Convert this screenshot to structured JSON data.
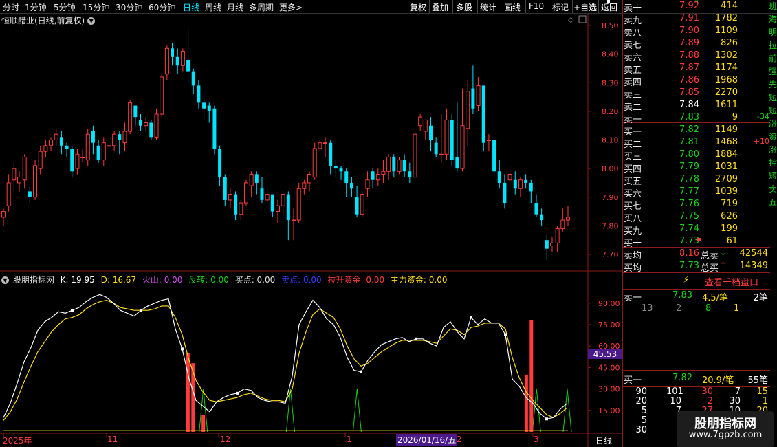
{
  "toolbar": {
    "periods": [
      "分时",
      "1分钟",
      "5分钟",
      "15分钟",
      "30分钟",
      "60分钟",
      "日线",
      "周线",
      "月线",
      "多周期",
      "更多"
    ],
    "active_period": "日线",
    "more_arrow": ">",
    "tools": [
      "复权",
      "叠加",
      "多股",
      "统计",
      "画线",
      "F10",
      "标记",
      "+自选",
      "返回"
    ]
  },
  "chart_title": "恒顺醋业(日线,前复权)",
  "price_axis": [
    "8.50",
    "8.40",
    "8.30",
    "8.20",
    "8.10",
    "8.00",
    "7.90",
    "7.80",
    "7.70"
  ],
  "indicator": {
    "name": "股朋指标网",
    "k_label": "K: 19.95",
    "d_label": "D: 16.67",
    "huoshan": "火山: 0.00",
    "fanzhuan": "反转: 0.00",
    "maidian": "买点: 0.00",
    "maidian2": "卖点: 0.00",
    "lasheng": "拉升资金: 0.00",
    "zhuli": "主力资金: 0.00",
    "axis": [
      "90.00",
      "75.00",
      "60.00",
      "45.00",
      "30.00",
      "15.00"
    ],
    "current_badge": "45.53"
  },
  "time_axis": {
    "labels": [
      "2025年",
      "11",
      "12",
      "1",
      "2",
      "3"
    ],
    "cursor_date": "2026/01/16/五",
    "period": "日线"
  },
  "orderbook": {
    "asks": [
      {
        "label": "卖十",
        "price": "7.92",
        "vol": "414",
        "flag": "*"
      },
      {
        "label": "卖九",
        "price": "7.91",
        "vol": "1782"
      },
      {
        "label": "卖八",
        "price": "7.90",
        "vol": "1109"
      },
      {
        "label": "卖七",
        "price": "7.89",
        "vol": "826"
      },
      {
        "label": "卖六",
        "price": "7.88",
        "vol": "1302"
      },
      {
        "label": "卖五",
        "price": "7.87",
        "vol": "1174"
      },
      {
        "label": "卖四",
        "price": "7.86",
        "vol": "1968"
      },
      {
        "label": "卖三",
        "price": "7.85",
        "vol": "2270"
      },
      {
        "label": "卖二",
        "price": "7.84",
        "vol": "1611"
      },
      {
        "label": "卖一",
        "price": "7.83",
        "vol": "9",
        "chg": "-34"
      }
    ],
    "bids": [
      {
        "label": "买一",
        "price": "7.82",
        "vol": "1149"
      },
      {
        "label": "买二",
        "price": "7.81",
        "vol": "1468",
        "chg": "+10"
      },
      {
        "label": "买三",
        "price": "7.80",
        "vol": "1884"
      },
      {
        "label": "买四",
        "price": "7.79",
        "vol": "1031"
      },
      {
        "label": "买五",
        "price": "7.78",
        "vol": "2709"
      },
      {
        "label": "买六",
        "price": "7.77",
        "vol": "1039"
      },
      {
        "label": "买七",
        "price": "7.76",
        "vol": "719"
      },
      {
        "label": "买八",
        "price": "7.75",
        "vol": "626"
      },
      {
        "label": "买九",
        "price": "7.74",
        "vol": "199"
      },
      {
        "label": "买十",
        "price": "7.73",
        "vol": "61"
      }
    ],
    "avg_sell_label": "卖均",
    "avg_sell": "8.16",
    "total_sell_label": "总卖",
    "total_sell": "42544",
    "avg_buy_label": "买均",
    "avg_buy": "7.73",
    "total_buy_label": "总买",
    "total_buy": "14349",
    "depth_button": "查看千档盘口",
    "ask1_detail": {
      "label": "卖一",
      "price": "7.83",
      "per": "4.5/笔",
      "count": "2笔"
    },
    "ask1_queue": [
      "13",
      "2",
      "8",
      "1"
    ],
    "bid1_detail": {
      "label": "买一",
      "price": "7.82",
      "per": "20.9/笔",
      "count": "55笔"
    },
    "bid1_queue": [
      [
        "90",
        "101",
        "30",
        "7",
        "15"
      ],
      [
        "20",
        "10",
        "2",
        "30",
        "1"
      ],
      [
        "5",
        "7",
        "27",
        "10",
        "20"
      ],
      [
        "5",
        "",
        "",
        "",
        ""
      ],
      [
        "30",
        "",
        "",
        "",
        ""
      ]
    ]
  },
  "side_text": [
    "班",
    "海",
    "明",
    "拉",
    "前",
    "强",
    "先",
    "短",
    "短",
    "涨",
    "资",
    "涨",
    "控",
    "短",
    "卖",
    "五"
  ],
  "watermark": {
    "title": "股朋指标网",
    "url": "www.7gpzb.com"
  },
  "colors": {
    "up": "#ff3c3c",
    "down": "#00e5ff",
    "k_line": "#ffffff",
    "d_line": "#ffde1a",
    "pulse": "#1ad01a"
  },
  "chart_data": [
    {
      "type": "candlestick",
      "title": "恒顺醋业(日线,前复权)",
      "y_range": [
        7.66,
        8.53
      ],
      "candles": [
        [
          7.83,
          7.85,
          7.8,
          7.86
        ],
        [
          7.87,
          7.95,
          7.85,
          7.98
        ],
        [
          7.96,
          8.0,
          7.92,
          8.02
        ],
        [
          7.95,
          7.97,
          7.92,
          7.99
        ],
        [
          7.96,
          8.04,
          7.93,
          8.05
        ],
        [
          7.92,
          7.9,
          7.88,
          7.94
        ],
        [
          7.9,
          8.01,
          7.89,
          8.03
        ],
        [
          8.0,
          8.06,
          7.98,
          8.08
        ],
        [
          8.06,
          8.08,
          8.04,
          8.1
        ],
        [
          8.08,
          8.1,
          8.06,
          8.11
        ],
        [
          8.1,
          8.12,
          8.08,
          8.14
        ],
        [
          8.11,
          8.08,
          8.05,
          8.13
        ],
        [
          8.08,
          8.07,
          8.04,
          8.09
        ],
        [
          8.07,
          7.99,
          7.97,
          8.08
        ],
        [
          8.0,
          8.05,
          7.98,
          8.07
        ],
        [
          8.04,
          8.04,
          8.02,
          8.07
        ],
        [
          8.03,
          8.12,
          8.01,
          8.14
        ],
        [
          8.13,
          8.09,
          8.05,
          8.15
        ],
        [
          8.08,
          8.03,
          8.02,
          8.1
        ],
        [
          8.03,
          8.09,
          8.01,
          8.11
        ],
        [
          8.08,
          8.08,
          8.06,
          8.1
        ],
        [
          8.08,
          8.12,
          8.06,
          8.13
        ],
        [
          8.12,
          8.1,
          8.05,
          8.13
        ],
        [
          8.09,
          8.13,
          8.06,
          8.16
        ],
        [
          8.13,
          8.23,
          8.12,
          8.24
        ],
        [
          8.22,
          8.18,
          8.15,
          8.22
        ],
        [
          8.17,
          8.15,
          8.13,
          8.19
        ],
        [
          8.15,
          8.16,
          8.13,
          8.18
        ],
        [
          8.16,
          8.11,
          8.1,
          8.17
        ],
        [
          8.11,
          8.19,
          8.1,
          8.21
        ],
        [
          8.19,
          8.32,
          8.18,
          8.33
        ],
        [
          8.33,
          8.42,
          8.31,
          8.43
        ],
        [
          8.42,
          8.39,
          8.36,
          8.44
        ],
        [
          8.39,
          8.36,
          8.33,
          8.42
        ],
        [
          8.36,
          8.41,
          8.34,
          8.42
        ],
        [
          8.38,
          8.34,
          8.3,
          8.49
        ],
        [
          8.34,
          8.29,
          8.26,
          8.35
        ],
        [
          8.29,
          8.23,
          8.21,
          8.31
        ],
        [
          8.23,
          8.21,
          8.17,
          8.26
        ],
        [
          8.22,
          8.2,
          8.16,
          8.23
        ],
        [
          8.21,
          8.07,
          8.05,
          8.22
        ],
        [
          8.07,
          7.97,
          7.94,
          8.08
        ],
        [
          7.97,
          7.89,
          7.87,
          7.98
        ],
        [
          7.89,
          7.91,
          7.86,
          7.93
        ],
        [
          7.91,
          7.84,
          7.82,
          7.92
        ],
        [
          7.84,
          7.88,
          7.82,
          7.89
        ],
        [
          7.88,
          7.95,
          7.87,
          7.96
        ],
        [
          7.94,
          7.98,
          7.9,
          7.99
        ],
        [
          7.98,
          7.95,
          7.91,
          7.99
        ],
        [
          7.93,
          7.89,
          7.88,
          7.97
        ],
        [
          7.89,
          7.91,
          7.88,
          7.93
        ],
        [
          7.91,
          7.85,
          7.83,
          7.91
        ],
        [
          7.85,
          7.87,
          7.81,
          7.89
        ],
        [
          7.87,
          7.91,
          7.84,
          7.92
        ],
        [
          7.91,
          7.82,
          7.75,
          7.92
        ],
        [
          7.82,
          7.82,
          7.75,
          7.86
        ],
        [
          7.82,
          7.93,
          7.81,
          7.95
        ],
        [
          7.93,
          7.95,
          7.91,
          7.96
        ],
        [
          7.95,
          7.98,
          7.92,
          7.99
        ],
        [
          7.97,
          8.07,
          7.96,
          8.09
        ],
        [
          8.07,
          8.09,
          8.06,
          8.1
        ],
        [
          8.09,
          8.09,
          8.04,
          8.11
        ],
        [
          8.09,
          8.01,
          7.98,
          8.1
        ],
        [
          8.01,
          8.0,
          7.97,
          8.03
        ],
        [
          8.0,
          7.99,
          7.96,
          8.01
        ],
        [
          7.99,
          7.95,
          7.9,
          8.0
        ],
        [
          7.95,
          7.93,
          7.9,
          7.97
        ],
        [
          7.9,
          7.84,
          7.83,
          7.94
        ],
        [
          7.84,
          7.91,
          7.83,
          7.92
        ],
        [
          7.93,
          7.96,
          7.9,
          7.99
        ],
        [
          7.99,
          7.96,
          7.93,
          8.0
        ],
        [
          7.96,
          7.98,
          7.94,
          8.0
        ],
        [
          7.98,
          7.99,
          7.95,
          8.03
        ],
        [
          7.99,
          8.04,
          7.96,
          8.05
        ],
        [
          8.04,
          7.99,
          7.97,
          8.05
        ],
        [
          7.99,
          8.03,
          7.98,
          8.04
        ],
        [
          8.03,
          7.99,
          7.97,
          8.05
        ],
        [
          7.99,
          7.97,
          7.95,
          8.02
        ],
        [
          7.97,
          8.12,
          7.96,
          8.21
        ],
        [
          8.15,
          8.18,
          8.13,
          8.19
        ],
        [
          8.13,
          8.17,
          8.1,
          8.17
        ],
        [
          8.15,
          8.1,
          8.06,
          8.18
        ],
        [
          8.09,
          8.05,
          8.04,
          8.11
        ],
        [
          8.05,
          8.05,
          8.02,
          8.19
        ],
        [
          8.05,
          8.17,
          8.03,
          8.21
        ],
        [
          8.17,
          8.03,
          8.01,
          8.19
        ],
        [
          8.04,
          8.0,
          7.99,
          8.23
        ],
        [
          8.0,
          8.15,
          7.99,
          8.28
        ],
        [
          8.14,
          8.27,
          8.08,
          8.31
        ],
        [
          8.28,
          8.21,
          8.19,
          8.36
        ],
        [
          8.22,
          8.29,
          8.2,
          8.32
        ],
        [
          8.29,
          8.09,
          8.06,
          8.29
        ],
        [
          8.1,
          8.1,
          8.06,
          8.12
        ],
        [
          8.1,
          7.99,
          7.97,
          8.1
        ],
        [
          7.99,
          7.95,
          7.93,
          8.03
        ],
        [
          7.95,
          7.88,
          7.86,
          7.98
        ],
        [
          7.96,
          7.98,
          7.94,
          8.01
        ],
        [
          7.96,
          7.93,
          7.91,
          7.99
        ],
        [
          7.93,
          7.96,
          7.9,
          7.97
        ],
        [
          7.96,
          7.95,
          7.93,
          7.98
        ],
        [
          7.95,
          7.92,
          7.88,
          7.96
        ],
        [
          7.88,
          7.84,
          7.83,
          7.91
        ],
        [
          7.84,
          7.82,
          7.8,
          7.86
        ],
        [
          7.75,
          7.72,
          7.68,
          7.77
        ],
        [
          7.73,
          7.74,
          7.71,
          7.76
        ],
        [
          7.74,
          7.79,
          7.71,
          7.8
        ],
        [
          7.79,
          7.82,
          7.78,
          7.86
        ],
        [
          7.82,
          7.83,
          7.8,
          7.87
        ]
      ]
    },
    {
      "type": "line",
      "title": "股朋指标网",
      "y_range": [
        0,
        100
      ],
      "series": [
        {
          "name": "K",
          "values": [
            10,
            20,
            34,
            49,
            59,
            71,
            77,
            80,
            84,
            83,
            85,
            87,
            91,
            94,
            96,
            94,
            90,
            85,
            83,
            81,
            85,
            88,
            90,
            92,
            93,
            72,
            58,
            37,
            22,
            18,
            14,
            21,
            24,
            26,
            27,
            30,
            29,
            24,
            22,
            21,
            21,
            20,
            39,
            75,
            84,
            92,
            87,
            79,
            75,
            66,
            52,
            43,
            42,
            50,
            56,
            61,
            63,
            65,
            66,
            63,
            65,
            65,
            62,
            60,
            73,
            77,
            70,
            65,
            80,
            75,
            79,
            76,
            76,
            68,
            37,
            32,
            24,
            20,
            13,
            9,
            10,
            16,
            20
          ]
        },
        {
          "name": "D",
          "values": [
            8,
            14,
            23,
            35,
            46,
            56,
            63,
            70,
            75,
            79,
            80,
            82,
            86,
            89,
            91,
            92,
            90,
            87,
            86,
            85,
            85,
            85,
            86,
            88,
            88,
            80,
            68,
            50,
            36,
            28,
            22,
            21,
            22,
            23,
            24,
            26,
            27,
            25,
            23,
            22,
            22,
            21,
            30,
            55,
            70,
            82,
            86,
            83,
            80,
            72,
            60,
            51,
            46,
            48,
            52,
            56,
            59,
            62,
            64,
            64,
            64,
            64,
            63,
            62,
            67,
            72,
            71,
            68,
            73,
            74,
            76,
            76,
            76,
            72,
            52,
            38,
            28,
            22,
            17,
            12,
            10,
            13,
            17
          ]
        },
        {
          "name": "拉升资金",
          "bars": [
            [
              36,
              55
            ],
            [
              37,
              48
            ],
            [
              39,
              12
            ],
            [
              102,
              40
            ],
            [
              103,
              78
            ]
          ]
        },
        {
          "name": "反转",
          "pulses": [
            39,
            56,
            69,
            104,
            110
          ]
        }
      ]
    }
  ]
}
